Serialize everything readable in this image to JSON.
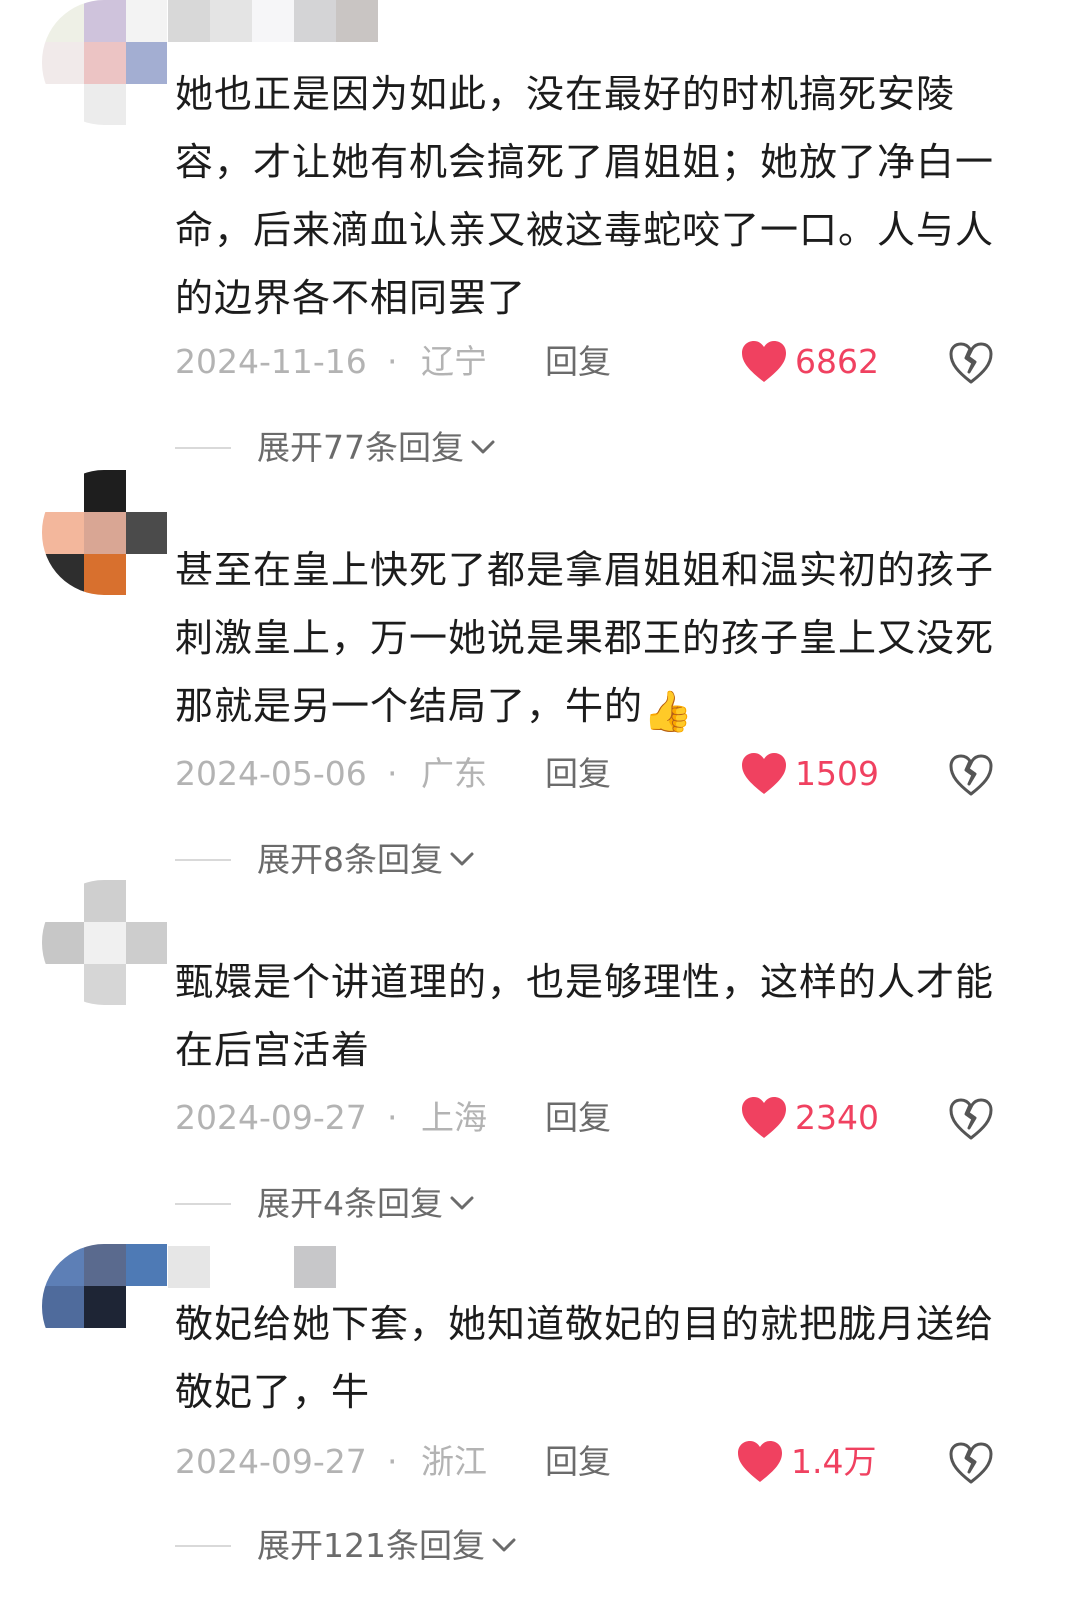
{
  "comments": [
    {
      "text": "她也正是因为如此，没在最好的时机搞死安陵容，才让她有机会搞死了眉姐姐；她放了净白一命，后来滴血认亲又被这毒蛇咬了一口。人与人的边界各不相同罢了",
      "date": "2024-11-16",
      "region": "辽宁",
      "reply_label": "回复",
      "likes": "6862",
      "expand_label": "展开77条回复"
    },
    {
      "text": "甚至在皇上快死了都是拿眉姐姐和温实初的孩子刺激皇上，万一她说是果郡王的孩子皇上又没死那就是另一个结局了，牛的",
      "emoji": "👍",
      "date": "2024-05-06",
      "region": "广东",
      "reply_label": "回复",
      "likes": "1509",
      "expand_label": "展开8条回复"
    },
    {
      "text": "甄嬛是个讲道理的，也是够理性，这样的人才能在后宫活着",
      "date": "2024-09-27",
      "region": "上海",
      "reply_label": "回复",
      "likes": "2340",
      "expand_label": "展开4条回复"
    },
    {
      "text": "敬妃给她下套，她知道敬妃的目的就把胧月送给敬妃了，牛",
      "date": "2024-09-27",
      "region": "浙江",
      "reply_label": "回复",
      "likes": "1.4万",
      "expand_label": "展开121条回复"
    }
  ],
  "meta_separator": "·",
  "colors": {
    "like_red": "#f04160",
    "meta_gray": "#b3b3b3",
    "reply_gray": "#6b6b6b",
    "text_dark": "#1c1c1c"
  },
  "icons": {
    "like": "heart-filled-icon",
    "dislike": "broken-heart-icon",
    "expand": "chevron-down-icon",
    "emoji": "thumbs-up-emoji"
  }
}
